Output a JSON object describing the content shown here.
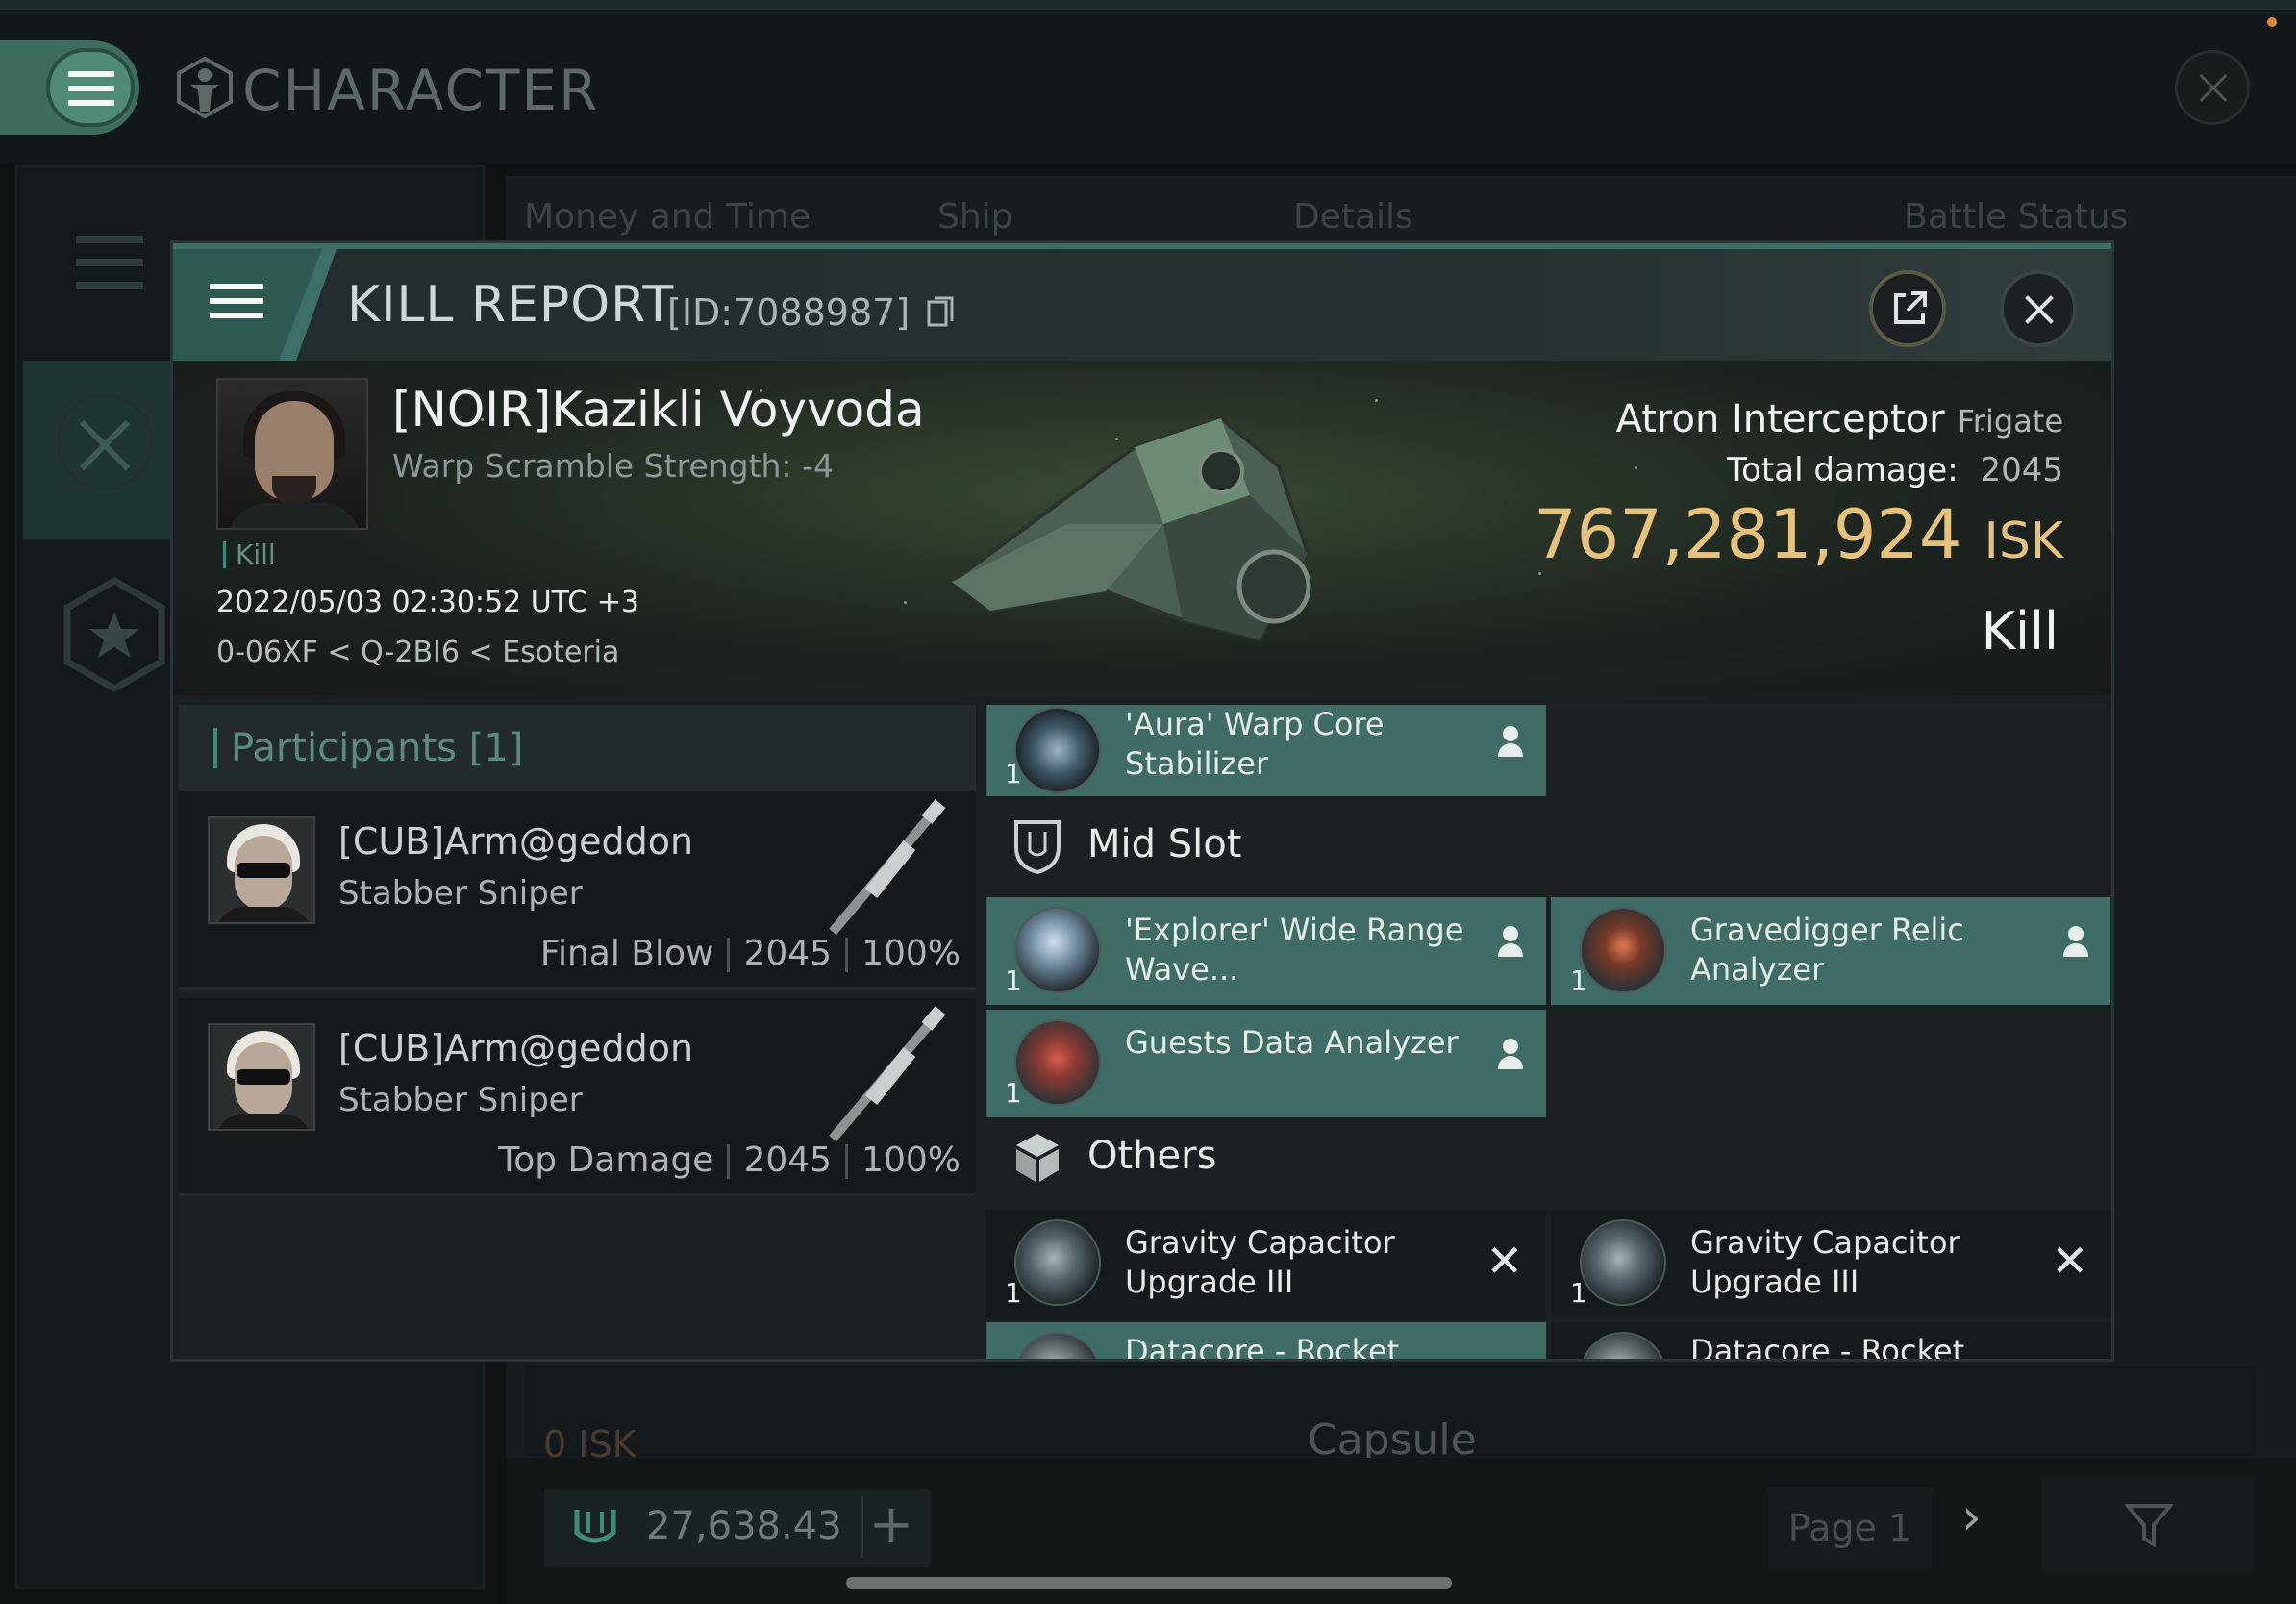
{
  "window": {
    "title": "CHARACTER"
  },
  "background": {
    "tabs": [
      "Money and Time",
      "Ship",
      "Details",
      "Battle Status"
    ],
    "row_isk": "0 ISK",
    "row_ship": "Capsule",
    "wallet_amount": "27,638.43",
    "page_label": "Page 1"
  },
  "kill_report": {
    "title": "KILL REPORT",
    "id": "[ID:7088987]",
    "victim": {
      "name": "[NOIR]Kazikli Voyvoda",
      "subtitle": "Warp Scramble Strength: -4",
      "tag": "Kill",
      "datetime": "2022/05/03 02:30:52 UTC +3",
      "location": "0-06XF < Q-2BI6 < Esoteria"
    },
    "ship": {
      "name": "Atron Interceptor",
      "class": "Frigate",
      "damage_label": "Total damage:",
      "damage_value": "2045",
      "isk_value": "767,281,924",
      "isk_unit": "ISK",
      "result": "Kill"
    },
    "participants": {
      "title": "Participants",
      "count": "[1]",
      "rows": [
        {
          "name": "[CUB]Arm@geddon",
          "ship": "Stabber Sniper",
          "role": "Final Blow",
          "damage": "2045",
          "percent": "100%"
        },
        {
          "name": "[CUB]Arm@geddon",
          "ship": "Stabber Sniper",
          "role": "Top Damage",
          "damage": "2045",
          "percent": "100%"
        }
      ]
    },
    "items": {
      "top_item": {
        "name": "'Aura' Warp Core Stabilizer",
        "qty": "1"
      },
      "mid_slot_title": "Mid Slot",
      "mid_slot": [
        {
          "name": "'Explorer' Wide Range Wave...",
          "qty": "1"
        },
        {
          "name": "Gravedigger Relic Analyzer",
          "qty": "1"
        },
        {
          "name": "Guests Data Analyzer",
          "qty": "1"
        }
      ],
      "others_title": "Others",
      "others": [
        {
          "name": "Gravity Capacitor Upgrade III",
          "qty": "1"
        },
        {
          "name": "Gravity Capacitor Upgrade III",
          "qty": "1"
        },
        {
          "name": "Datacore - Rocket",
          "qty": ""
        },
        {
          "name": "Datacore - Rocket",
          "qty": ""
        }
      ]
    }
  }
}
